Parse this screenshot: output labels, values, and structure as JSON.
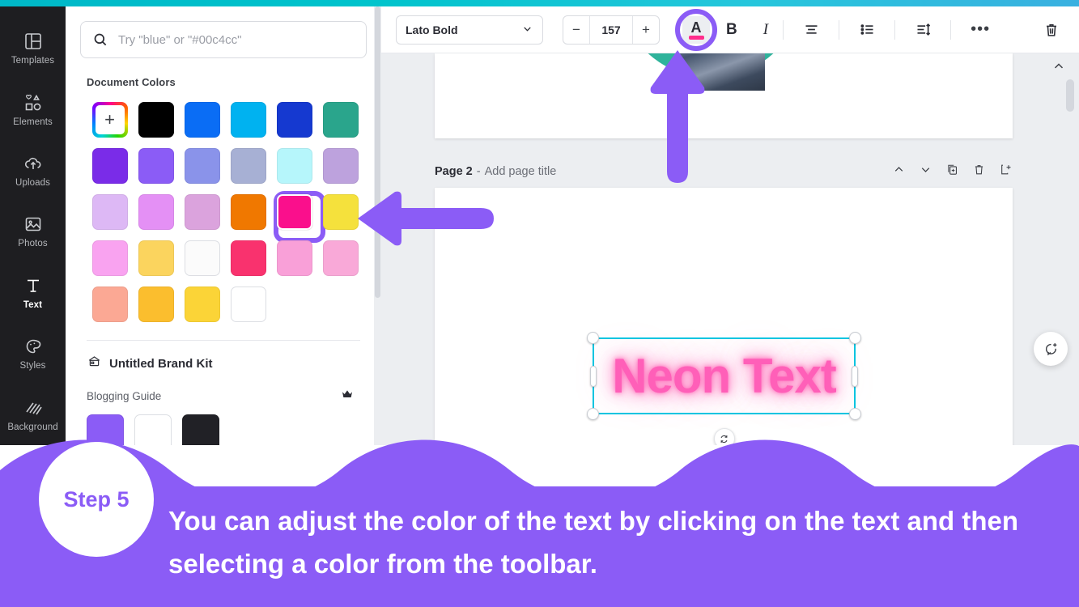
{
  "sidebar": {
    "items": [
      {
        "label": "Templates",
        "icon": "templates-icon",
        "active": false
      },
      {
        "label": "Elements",
        "icon": "elements-icon",
        "active": false
      },
      {
        "label": "Uploads",
        "icon": "uploads-icon",
        "active": false
      },
      {
        "label": "Photos",
        "icon": "photos-icon",
        "active": false
      },
      {
        "label": "Text",
        "icon": "text-icon",
        "active": true
      },
      {
        "label": "Styles",
        "icon": "styles-icon",
        "active": false
      },
      {
        "label": "Background",
        "icon": "background-icon",
        "active": false
      }
    ]
  },
  "panel": {
    "search": {
      "placeholder": "Try \"blue\" or \"#00c4cc\"",
      "value": ""
    },
    "document_colors_title": "Document Colors",
    "add_color_label": "+",
    "swatches": [
      "#000000",
      "#0a6df5",
      "#00b2f0",
      "#1539d0",
      "#2aa58c",
      "#7a2ce8",
      "#8b5cf6",
      "#8a93ea",
      "#a7b0d4",
      "#b6f6fb",
      "#bda2dd",
      "#ddb8f5",
      "#e490f5",
      "#dba3dd",
      "#f07800",
      "#fa0f8c",
      "#f5e13c",
      "#f9a3f0",
      "#fbd45e",
      "#fbfbfb",
      "#f9326e",
      "#f9a0d8",
      "#f9a9d8",
      "#fba894",
      "#fbbe2e",
      "#fbd437",
      "#ffffff"
    ],
    "selected_swatch": "#fa0f8c",
    "brand_kit": {
      "name": "Untitled Brand Kit",
      "icon": "brand-kit-icon"
    },
    "brand_palette": {
      "name": "Blogging Guide",
      "crown_icon": "crown-icon",
      "colors": [
        "#8b5cf6",
        "#ffffff",
        "#212126"
      ]
    }
  },
  "toolbar": {
    "font_family": "Lato Bold",
    "font_size": "157",
    "decrease_label": "−",
    "increase_label": "+",
    "text_color_label": "A",
    "text_color_value": "#ff2d8c",
    "bold_label": "B",
    "italic_label": "I",
    "align_icon": "align-center-icon",
    "list_icon": "bullet-list-icon",
    "spacing_icon": "line-spacing-icon",
    "more_label": "•••",
    "delete_icon": "trash-icon"
  },
  "canvas": {
    "page_header": {
      "page_label": "Page 2",
      "separator": "-",
      "title_placeholder": "Add page title",
      "actions": [
        "move-up-icon",
        "move-down-icon",
        "duplicate-icon",
        "delete-icon",
        "add-page-icon"
      ]
    },
    "text_element": {
      "content": "Neon Text",
      "color": "#ff5fb8"
    },
    "rotate_icon": "rotate-icon",
    "comment_icon": "add-comment-icon",
    "scroll_up_icon": "chevron-up-icon"
  },
  "annotations": {
    "arrow_up": "arrow-up-annotation",
    "arrow_left": "arrow-left-annotation",
    "accent_color": "#8b5cf6"
  },
  "caption": {
    "step_label": "Step 5",
    "text": "You can adjust the color of the text by clicking on the text and then selecting a color from the toolbar.",
    "background": "#8b5cf6"
  }
}
